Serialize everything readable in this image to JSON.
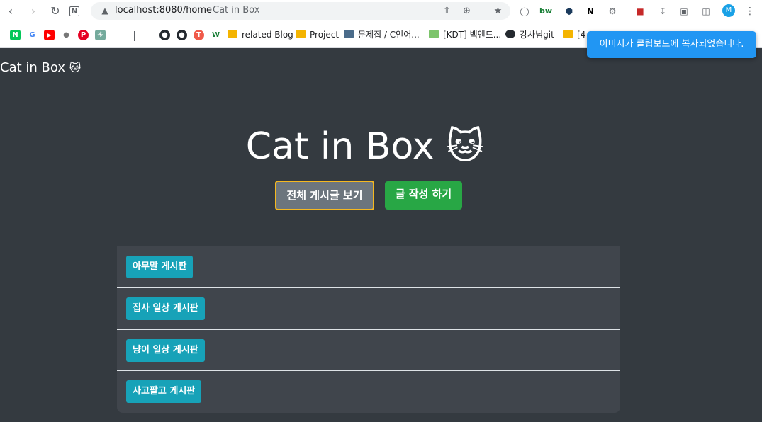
{
  "browser": {
    "url": "localhost:8080/home",
    "tab_title": "Cat in Box",
    "profile_initial": "M",
    "bookmarks": {
      "related_blog": "related Blog",
      "project": "Project",
      "problem_set": "문제집 / C언어...",
      "kdt": "[KDT] 백엔드...",
      "instructor_git": "강사님git",
      "truncated": "[4"
    }
  },
  "page": {
    "brand": "Cat in Box",
    "brand_emoji": "🐱",
    "hero_title": "Cat in Box",
    "hero_emoji": "🐱",
    "buttons": {
      "view_all": "전체 게시글 보기",
      "write": "글 작성 하기"
    },
    "boards": [
      {
        "label": "아무말 게시판"
      },
      {
        "label": "집사 일상 게시판"
      },
      {
        "label": "냥이 일상 게시판"
      },
      {
        "label": "사고팔고 게시판"
      }
    ]
  },
  "toast": {
    "message": "이미지가 클립보드에 복사되었습니다."
  },
  "colors": {
    "page_bg": "#343a40",
    "list_bg": "#40454c",
    "badge": "#17a2b8",
    "btn_secondary": "#6c757d",
    "btn_success": "#28a745",
    "focus_ring": "#f5b820",
    "toast_bg": "#2196f3"
  }
}
